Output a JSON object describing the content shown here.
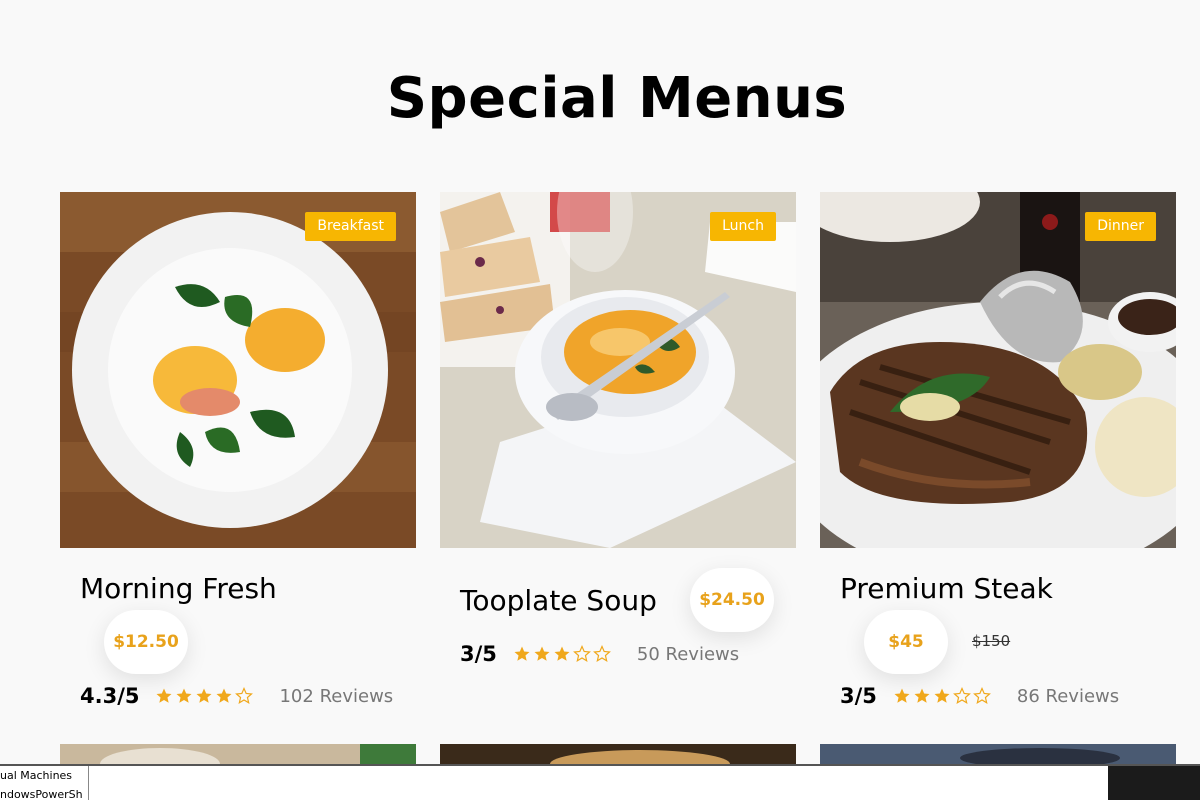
{
  "section_title": "Special Menus",
  "menus": [
    {
      "badge": "Breakfast",
      "name": "Morning Fresh",
      "price": "$12.50",
      "old_price": "",
      "score": "4.3/5",
      "stars_filled": 4,
      "reviews": "102 Reviews",
      "image": "eggs-benedict-plate"
    },
    {
      "badge": "Lunch",
      "name": "Tooplate Soup",
      "price": "$24.50",
      "old_price": "",
      "score": "3/5",
      "stars_filled": 3,
      "reviews": "50 Reviews",
      "image": "soup-bowl"
    },
    {
      "badge": "Dinner",
      "name": "Premium Steak",
      "price": "$45",
      "old_price": "$150",
      "score": "3/5",
      "stars_filled": 3,
      "reviews": "86 Reviews",
      "image": "steak-plate"
    }
  ],
  "taskbar": {
    "item1": "ual Machines",
    "item2": "ndowsPowerSh"
  },
  "colors": {
    "accent": "#f7b602",
    "price": "#e8a21b",
    "star": "#f0a81c"
  }
}
